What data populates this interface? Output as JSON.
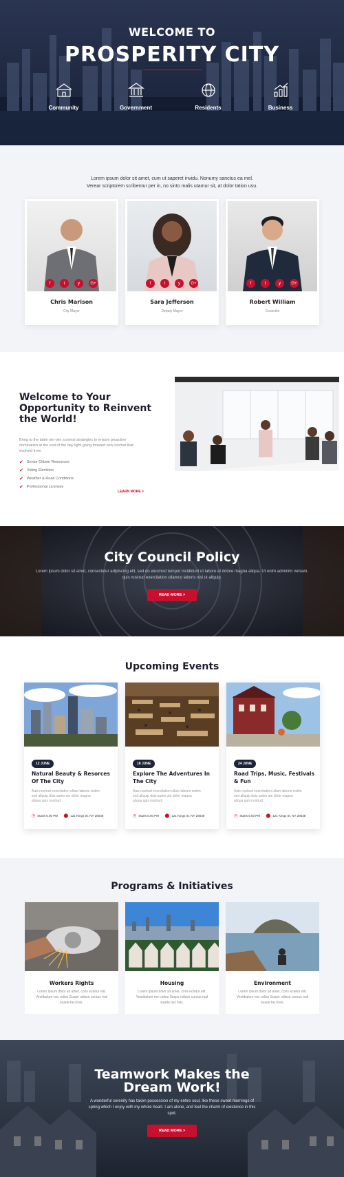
{
  "hero": {
    "welcome": "WELCOME TO",
    "title": "PROSPERITY CITY",
    "categories": [
      {
        "label": "Community",
        "icon": "community-icon"
      },
      {
        "label": "Government",
        "icon": "government-icon"
      },
      {
        "label": "Residents",
        "icon": "residents-icon"
      },
      {
        "label": "Business",
        "icon": "business-icon"
      }
    ]
  },
  "people": {
    "intro_line1": "Lorem ipsum dolor sit amet, cum ut saperet invidu. Nonumy sanctus ea mel.",
    "intro_line2": "Verear scriptorem scribentur per in, no sinto malis utamur sit, at dolor tation usu.",
    "cards": [
      {
        "name": "Chris Marison",
        "role": "City Mayor"
      },
      {
        "name": "Sara Jefferson",
        "role": "Deputy Mayor"
      },
      {
        "name": "Robert William",
        "role": "Councilor"
      }
    ],
    "social_icons": [
      "f",
      "t",
      "y",
      "G+"
    ]
  },
  "opportunity": {
    "title": "Welcome to Your Opportunity to Reinvent the World!",
    "description": "Bring to the table win-win survival strategies to ensure proactive domination at the end of the day light going forward new normal that evolved from",
    "items": [
      "Senior Citizen Resources",
      "Voting Elections",
      "Weather & Road Conditions",
      "Professional Licenses"
    ],
    "learn_more": "LEARN MORE >"
  },
  "policy": {
    "title": "City Council Policy",
    "text": "Lorem ipsum dolor sit amet, consectetur adipiscing elit, sed do eiusmod tempor incididunt ut labore et dolore magna aliqua. Ut enim adminim veniam, quis nostrud exercitation ullamco laboris nisi ut aliquip.",
    "button": "READ MORE >"
  },
  "events": {
    "title": "Upcoming Events",
    "items": [
      {
        "date": "12 JUNE",
        "title": "Natural Beauty & Resorces Of The City",
        "desc": "Auis nostrud exercitation ullam laboris nisitm sed aliquip duis autes ute dolor magna aliqua quis nostrud.",
        "time": "Starts 5.00 PM",
        "location": "121 Kings St. NY 28038"
      },
      {
        "date": "18 JUNE",
        "title": "Explore The Adventures In The City",
        "desc": "Auis nostrud exercitation ullam laboris nisitm sed aliquip duis autes ute dolor magna aliqua quis nostrud.",
        "time": "Starts 5.00 PM",
        "location": "121 Kings St. NY 28038"
      },
      {
        "date": "24 JUNE",
        "title": "Road Trips, Music, Festivals & Fun",
        "desc": "Auis nostrud exercitation ullam laboris nisitm sed aliquip duis autes ute dolor magna aliqua quis nostrud.",
        "time": "Starts 5.00 PM",
        "location": "121 Kings St. NY 28038"
      }
    ]
  },
  "programs": {
    "title": "Programs & Initiatives",
    "items": [
      {
        "title": "Workers Rights",
        "desc": "Lorem ipsum dolor sit amet, cons ectetur elit. Vestibulum nec odios Suspe ndisse cursus mal suada faci lisis."
      },
      {
        "title": "Housing",
        "desc": "Lorem ipsum dolor sit amet, cons ectetur elit. Vestibulum nec odios Suspe ndisse cursus mal suada faci lisis."
      },
      {
        "title": "Environment",
        "desc": "Lorem ipsum dolor sit amet, cons ectetur elit. Vestibulum nec odios Suspe ndisse cursus mal suada faci lisis."
      }
    ]
  },
  "teamwork": {
    "title_line1": "Teamwork Makes the",
    "title_line2": "Dream Work!",
    "text": "A wonderful serenity has taken possession of my entire soul, like these sweet mornings of spring which I enjoy with my whole heart. I am alone, and feel the charm of existence in this spot.",
    "button": "READ MORE >"
  },
  "colors": {
    "accent": "#c8102e",
    "dark": "#1f2338",
    "light_bg": "#f3f4f8"
  }
}
